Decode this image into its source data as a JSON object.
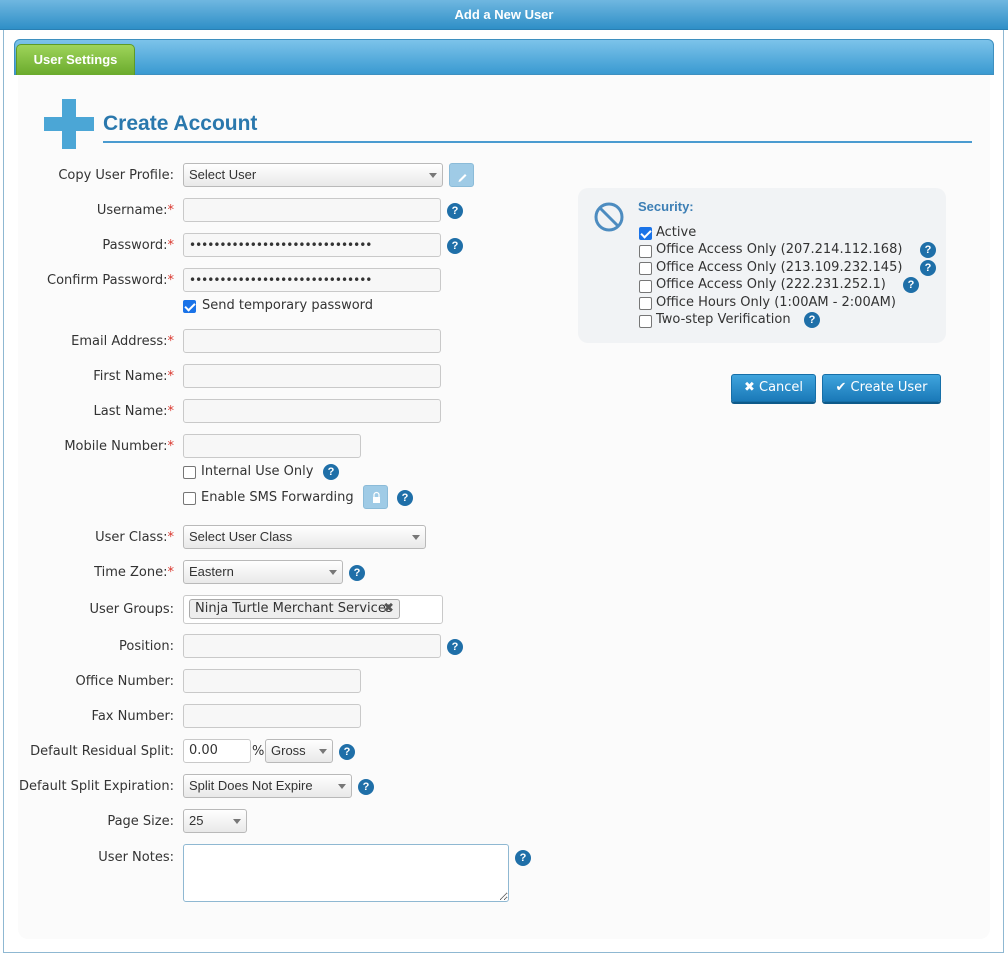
{
  "window": {
    "title": "Add a New User"
  },
  "tabs": [
    {
      "label": "User Settings",
      "active": true
    }
  ],
  "section": {
    "heading": "Create Account"
  },
  "form": {
    "copy_profile": {
      "label": "Copy User Profile:",
      "value": "Select User"
    },
    "username": {
      "label": "Username:",
      "required": "*",
      "value": ""
    },
    "password": {
      "label": "Password:",
      "required": "*",
      "value": "••••••••••••••••••••••••••••••"
    },
    "confirm_password": {
      "label": "Confirm Password:",
      "required": "*",
      "value": "••••••••••••••••••••••••••••••"
    },
    "send_temp_password": {
      "label": "Send temporary password",
      "checked": true
    },
    "email": {
      "label": "Email Address:",
      "required": "*",
      "value": ""
    },
    "first_name": {
      "label": "First Name:",
      "required": "*",
      "value": ""
    },
    "last_name": {
      "label": "Last Name:",
      "required": "*",
      "value": ""
    },
    "mobile": {
      "label": "Mobile Number:",
      "required": "*",
      "value": ""
    },
    "internal_use": {
      "label": "Internal Use Only",
      "checked": false
    },
    "sms_forwarding": {
      "label": "Enable SMS Forwarding",
      "checked": false
    },
    "user_class": {
      "label": "User Class:",
      "required": "*",
      "value": "Select User Class"
    },
    "time_zone": {
      "label": "Time Zone:",
      "required": "*",
      "value": "Eastern"
    },
    "user_groups": {
      "label": "User Groups:",
      "tags": [
        "Ninja Turtle Merchant Services"
      ],
      "remove_glyph": "✖"
    },
    "position": {
      "label": "Position:",
      "value": ""
    },
    "office_number": {
      "label": "Office Number:",
      "value": ""
    },
    "fax_number": {
      "label": "Fax Number:",
      "value": ""
    },
    "residual_split": {
      "label": "Default Residual Split:",
      "value": "0.00",
      "unit": "%",
      "basis": "Gross"
    },
    "split_expiration": {
      "label": "Default Split Expiration:",
      "value": "Split Does Not Expire"
    },
    "page_size": {
      "label": "Page Size:",
      "value": "25"
    },
    "user_notes": {
      "label": "User Notes:",
      "value": ""
    }
  },
  "help_glyph": "?",
  "security": {
    "title": "Security:",
    "options": [
      {
        "label": "Active",
        "checked": true,
        "help": false
      },
      {
        "label": "Office Access Only (207.214.112.168)",
        "checked": false,
        "help": true
      },
      {
        "label": "Office Access Only (213.109.232.145)",
        "checked": false,
        "help": true
      },
      {
        "label": "Office Access Only (222.231.252.1)",
        "checked": false,
        "help": true
      },
      {
        "label": "Office Hours Only (1:00AM - 2:00AM)",
        "checked": false,
        "help": false
      },
      {
        "label": "Two-step Verification",
        "checked": false,
        "help": true
      }
    ]
  },
  "actions": {
    "cancel": "Cancel",
    "create": "Create User"
  },
  "colors": {
    "accent": "#2a78ad",
    "required": "#d9342b",
    "tab_green": "#6aaa2c",
    "button_blue": "#1a79b8"
  }
}
